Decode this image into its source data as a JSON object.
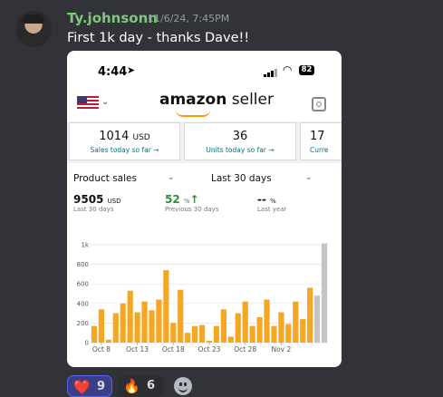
{
  "message": {
    "username": "Ty.johnsonn",
    "timestamp": "11/6/24, 7:45PM",
    "text": "First 1k day - thanks Dave!!"
  },
  "phone": {
    "time": "4:44",
    "battery": "82"
  },
  "seller_app": {
    "logo_bold": "amazon",
    "logo_light": "seller",
    "cards": [
      {
        "value": "1014",
        "unit": "USD",
        "link": "Sales today so far →"
      },
      {
        "value": "36",
        "unit": "",
        "link": "Units today so far →"
      },
      {
        "value": "17",
        "unit": "",
        "link": "Curre"
      }
    ],
    "metric_dropdown": "Product sales",
    "range_dropdown": "Last 30 days",
    "stats": [
      {
        "value": "9505",
        "unit": "USD",
        "sub": "Last 30 days"
      },
      {
        "value": "52",
        "unit": "%",
        "arrow": "↑",
        "sub": "Previous 30 days"
      },
      {
        "value": "--",
        "unit": "%",
        "sub": "Last year"
      }
    ]
  },
  "chart_data": {
    "type": "bar",
    "ylim": [
      0,
      1000
    ],
    "yticks": [
      "0",
      "200",
      "400",
      "600",
      "800",
      "1k"
    ],
    "xticks": [
      "Oct 8",
      "Oct 13",
      "Oct 18",
      "Oct 23",
      "Oct 28",
      "Nov 2"
    ],
    "values": [
      170,
      340,
      30,
      300,
      400,
      530,
      310,
      420,
      330,
      440,
      740,
      200,
      540,
      100,
      170,
      180,
      20,
      170,
      340,
      60,
      300,
      420,
      170,
      260,
      440,
      170,
      310,
      190,
      420,
      240,
      560,
      480,
      1014
    ],
    "colors": [
      "#f5a623",
      "#c4c4c4"
    ],
    "today_color_index_from": 31
  },
  "reactions": [
    {
      "emoji": "❤️",
      "count": "9",
      "active": true
    },
    {
      "emoji": "🔥",
      "count": "6",
      "active": false
    }
  ]
}
